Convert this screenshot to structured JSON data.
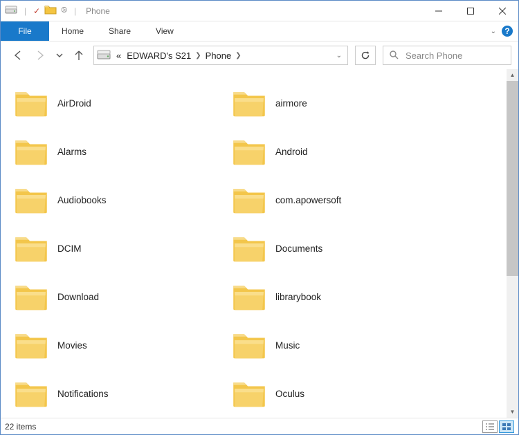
{
  "window": {
    "title": "Phone"
  },
  "ribbon": {
    "file": "File",
    "tabs": [
      "Home",
      "Share",
      "View"
    ]
  },
  "breadcrumb": {
    "parent": "EDWARD's S21",
    "current": "Phone"
  },
  "search": {
    "placeholder": "Search Phone"
  },
  "folders": [
    {
      "name": "AirDroid"
    },
    {
      "name": "Alarms"
    },
    {
      "name": "Audiobooks"
    },
    {
      "name": "DCIM"
    },
    {
      "name": "Download"
    },
    {
      "name": "Movies"
    },
    {
      "name": "Notifications"
    },
    {
      "name": "airmore"
    },
    {
      "name": "Android"
    },
    {
      "name": "com.apowersoft"
    },
    {
      "name": "Documents"
    },
    {
      "name": "librarybook"
    },
    {
      "name": "Music"
    },
    {
      "name": "Oculus"
    }
  ],
  "status": {
    "item_count": "22 items"
  }
}
